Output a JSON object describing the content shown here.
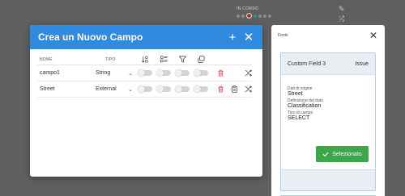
{
  "background": {
    "status_label": "IN CORSO"
  },
  "modal": {
    "title": "Crea un Nuovo Campo",
    "add_icon": "plus-icon",
    "close_icon": "close-icon",
    "columns": {
      "name": "NOME",
      "type": "TIPO"
    },
    "column_icons": [
      "sort-numeric-icon",
      "list-detail-icon",
      "filter-icon",
      "copy-icon"
    ],
    "rows": [
      {
        "name": "campo1",
        "type": "String",
        "toggles": [
          false,
          false,
          false,
          false
        ]
      },
      {
        "name": "Street",
        "type": "External",
        "toggles": [
          false,
          false,
          false,
          false
        ]
      }
    ]
  },
  "panel": {
    "title": "Fonte",
    "card": {
      "name": "Custom Field 3",
      "kind": "Issue",
      "origin_label": "Dati di origine",
      "origin_value": "Street",
      "definition_label": "Definizione del dato",
      "definition_value": "Classification",
      "field_type_label": "Tipo di campo",
      "field_type_value": "SELECT",
      "select_label": "Selezionato"
    }
  },
  "colors": {
    "header_blue": "#2f8ae0",
    "delete_red": "#e23b3b",
    "selected_green": "#3da54a",
    "overlay": "#5f5f5f"
  }
}
